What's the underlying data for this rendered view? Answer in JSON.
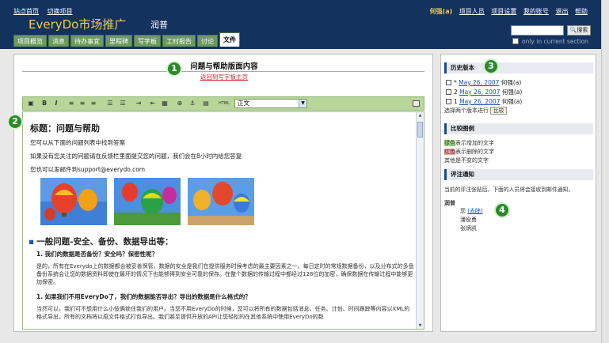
{
  "header": {
    "links": [
      "站点首页",
      "切换项目"
    ],
    "app_title": "EveryDo市场推广",
    "app_subtitle": "润普",
    "user": "何强(a)",
    "user_links": [
      "项目人员",
      "项目设置",
      "我的账号",
      "退出",
      "帮助"
    ],
    "search_placeholder": "",
    "search_button": "搜索",
    "only_current": "only in current section"
  },
  "tabs": [
    "项目概览",
    "消息",
    "待办事宜",
    "里程碑",
    "写字板",
    "工时报告",
    "讨论",
    "文件"
  ],
  "active_tab": "文件",
  "document": {
    "title": "问题与帮助版面内容",
    "back_link": "返回到写字板主页",
    "style_select": "正文",
    "toolbar_html": "HTML"
  },
  "editor": {
    "heading": "标题：问题与帮助",
    "p1": "您可以从下面的问题列表中找到答案",
    "p2": "如果没有您关注的问题请在反馈栏里面提交您的问题，我们会在8小时内给您答复",
    "p3": "您也可以发邮件到support@everydo.com",
    "section": "一般问题-安全、备份、数据导出等：",
    "q1": "1.  我们的数据是否备份？安全吗？保密性呢？",
    "a1": "是的，所有在Everydo上的数据都会被妥善保管，数据的安全是我们在提供服务时候考虑的最主要因素之一。每日定时的常规数据备份，以及分布式的多盘备份系统会让您的数据资料即使在最坏的情况下也能够得到安全可靠的保存。在整个数据的传输过程中都经过128位的加密，确保数据在传输过程中能够更加保密。",
    "q2": "1.  如果我们不用EveryDo了，我们的数据能否导出？导出的数据是什么格式的？",
    "a2": "当然可以，我们可不想用什么小伎俩锁住我们的用户。当您不用EveryDo的时候，您可以将所有的数据包括消息、任务、计划、时间跟踪等内容以XML的格式导出，所有的文档将以原文件格式打包导出。我们甚至提供开放的API让您轻松的在其他系统中使用EveryDo的数"
  },
  "side": {
    "history_title": "历史版本",
    "versions": [
      {
        "num": "*",
        "date": "May 26, 2007",
        "user": "何强(a)"
      },
      {
        "num": "2",
        "date": "May 26, 2007",
        "user": "何强(a)"
      },
      {
        "num": "1",
        "date": "May 26, 2007",
        "user": "何强(a)"
      }
    ],
    "choose_two": "选择两个版本进行",
    "compare_button": "比较",
    "legend_title": "比较图例",
    "legend_green_word": "绿色",
    "legend_green_rest": "表示增加的文字",
    "legend_red_word": "红色",
    "legend_red_rest": "表示删除的文字",
    "legend_other": "其他是不变的文字",
    "notify_title": "评注通知",
    "notify_text": "当前的评注张贴后，下面的人员将会接收到邮件通知。",
    "group": "润普",
    "people": [
      {
        "name": "您",
        "extra": "(去除)"
      },
      {
        "name": "潘役勇",
        "extra": ""
      },
      {
        "name": "张炳凯",
        "extra": ""
      }
    ]
  },
  "callouts": [
    "1",
    "2",
    "3",
    "4"
  ],
  "colors": {
    "header_bg": "#14325e",
    "title_color": "#f2c94c",
    "tab_green": "#6b9a5a",
    "toolbar_green": "#b8d69a",
    "callout_green": "#2c8a2c"
  }
}
